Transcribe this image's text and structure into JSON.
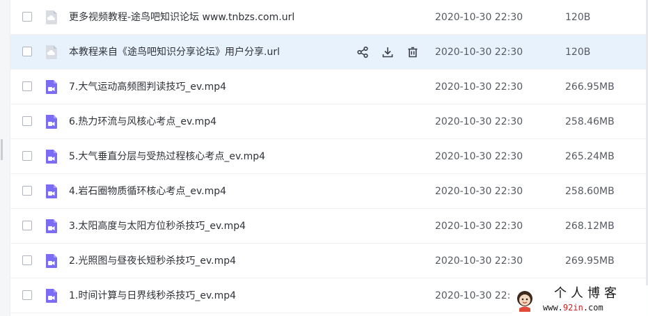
{
  "files": [
    {
      "name": "更多视频教程-途鸟吧知识论坛 www.tnbzs.com.url",
      "date": "2020-10-30 22:30",
      "size": "120B",
      "type": "url"
    },
    {
      "name": "本教程来自《途鸟吧知识分享论坛》用户分享.url",
      "date": "2020-10-30 22:30",
      "size": "120B",
      "type": "url"
    },
    {
      "name": "7.大气运动高频图判读技巧_ev.mp4",
      "date": "2020-10-30 22:30",
      "size": "266.95MB",
      "type": "video"
    },
    {
      "name": "6.热力环流与风核心考点_ev.mp4",
      "date": "2020-10-30 22:30",
      "size": "258.46MB",
      "type": "video"
    },
    {
      "name": "5.大气垂直分层与受热过程核心考点_ev.mp4",
      "date": "2020-10-30 22:30",
      "size": "265.24MB",
      "type": "video"
    },
    {
      "name": "4.岩石圈物质循环核心考点_ev.mp4",
      "date": "2020-10-30 22:30",
      "size": "258.60MB",
      "type": "video"
    },
    {
      "name": "3.太阳高度与太阳方位秒杀技巧_ev.mp4",
      "date": "2020-10-30 22:30",
      "size": "268.12MB",
      "type": "video"
    },
    {
      "name": "2.光照图与昼夜长短秒杀技巧_ev.mp4",
      "date": "2020-10-30 22:30",
      "size": "269.95MB",
      "type": "video"
    },
    {
      "name": "1.时间计算与日界线秒杀技巧_ev.mp4",
      "date": "2020-10-30 22:",
      "size": "",
      "type": "video"
    }
  ],
  "hover_row": 1,
  "actions": [
    "share-icon",
    "download-icon",
    "delete-icon"
  ],
  "watermark": {
    "title": "个人博客",
    "url_prefix": "www.",
    "url_highlight": "92in",
    "url_suffix": ".com"
  },
  "colors": {
    "hover_bg": "#e8f2fd",
    "video_icon": "#7b6cf6",
    "url_icon": "#d9dde3",
    "accent_red": "#d21f1f"
  }
}
